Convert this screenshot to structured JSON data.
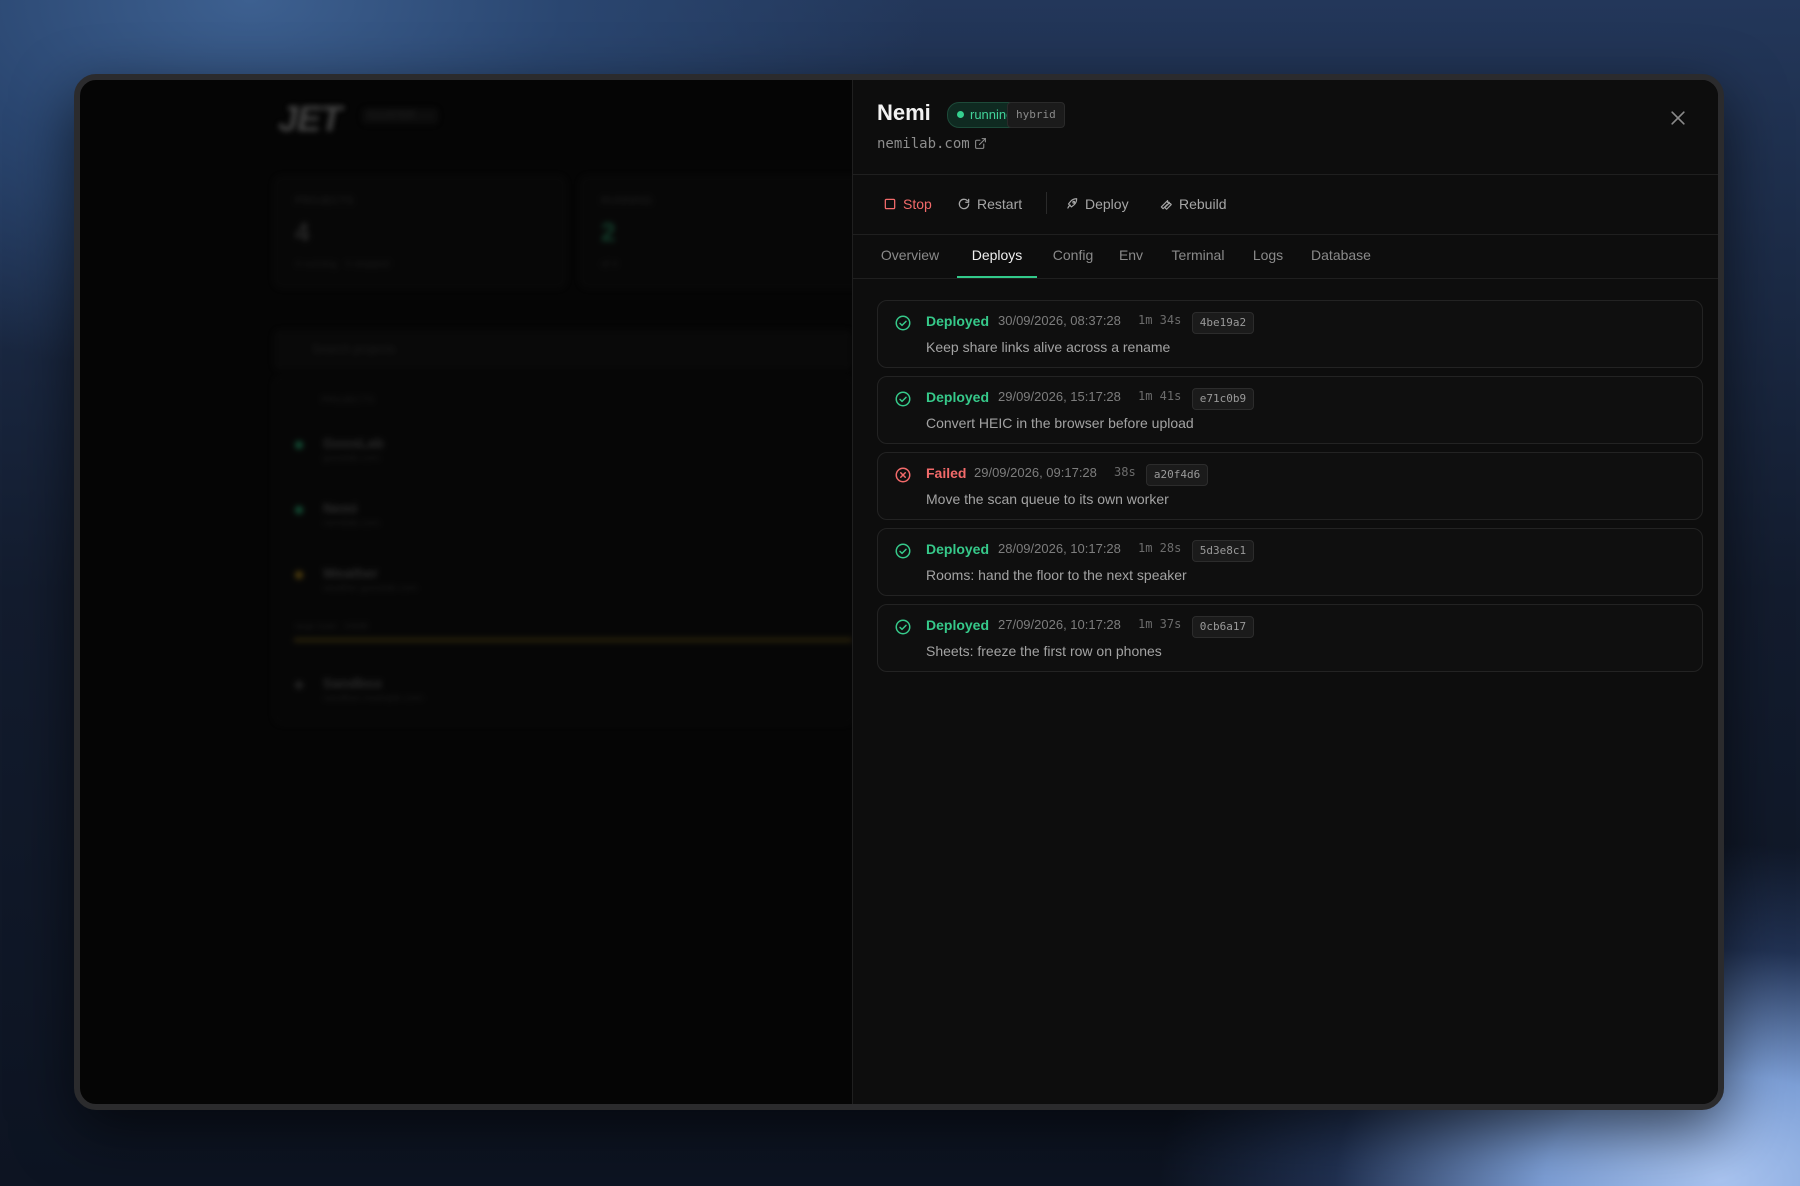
{
  "background_app": {
    "logo": "JET",
    "chip": "CLUSTER",
    "cards": [
      {
        "label": "PROJECTS",
        "value": "4",
        "sub": "4 running · 0 stopped"
      },
      {
        "label": "RUNNING",
        "value": "2",
        "sub": "of 4"
      }
    ],
    "search_placeholder": "Search projects",
    "list_header": "PROJECTS",
    "projects": [
      {
        "name": "GoosLab",
        "domain": "gooslab.com",
        "dot": "#1f8a5c"
      },
      {
        "name": "Nemi",
        "domain": "nemilab.com",
        "dot": "#1f8a5c"
      },
      {
        "name": "Weather",
        "domain": "weather.gooslab.com",
        "dot": "#8a6a15"
      },
      {
        "name": "Sandbox",
        "domain": "sandbox.example.com",
        "dot": "#3a3a3a"
      }
    ],
    "progress_label": "large build · 64MB"
  },
  "project": {
    "name": "Nemi",
    "status": "running",
    "mode": "hybrid",
    "domain": "nemilab.com"
  },
  "actions": {
    "stop": "Stop",
    "restart": "Restart",
    "deploy": "Deploy",
    "rebuild": "Rebuild"
  },
  "tabs": [
    "Overview",
    "Deploys",
    "Config",
    "Env",
    "Terminal",
    "Logs",
    "Database"
  ],
  "active_tab": "Deploys",
  "deploys": [
    {
      "status": "Deployed",
      "timestamp": "30/09/2026, 08:37:28",
      "duration": "1m 34s",
      "commit": "4be19a2",
      "message": "Keep share links alive across a rename"
    },
    {
      "status": "Deployed",
      "timestamp": "29/09/2026, 15:17:28",
      "duration": "1m 41s",
      "commit": "e71c0b9",
      "message": "Convert HEIC in the browser before upload"
    },
    {
      "status": "Failed",
      "timestamp": "29/09/2026, 09:17:28",
      "duration": "38s",
      "commit": "a20f4d6",
      "message": "Move the scan queue to its own worker"
    },
    {
      "status": "Deployed",
      "timestamp": "28/09/2026, 10:17:28",
      "duration": "1m 28s",
      "commit": "5d3e8c1",
      "message": "Rooms: hand the floor to the next speaker"
    },
    {
      "status": "Deployed",
      "timestamp": "27/09/2026, 10:17:28",
      "duration": "1m 37s",
      "commit": "0cb6a17",
      "message": "Sheets: freeze the first row on phones"
    }
  ],
  "colors": {
    "accent": "#32c98a",
    "success": "#36c98a",
    "danger": "#f26a6a"
  }
}
